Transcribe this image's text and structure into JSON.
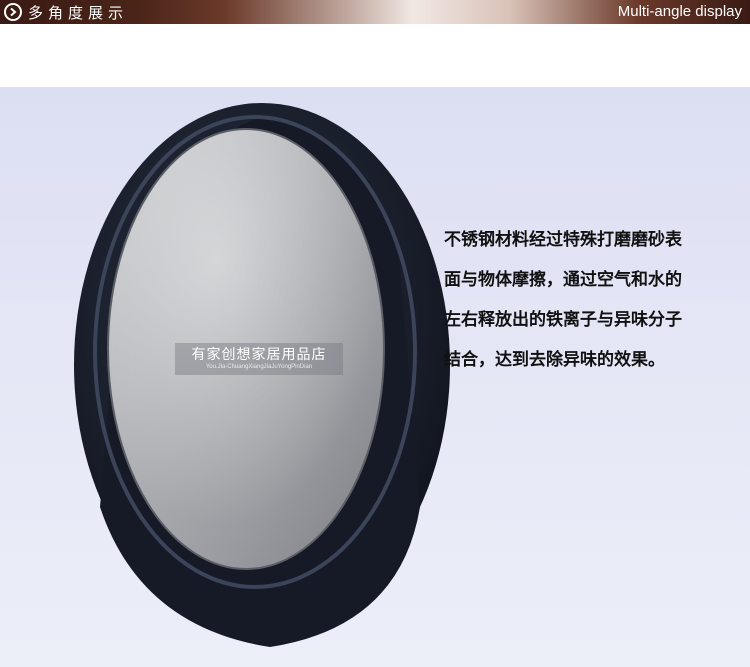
{
  "header": {
    "title_cn": "多角度展示",
    "title_en": "Multi-angle display",
    "icon": "chevron-right-circle-icon"
  },
  "watermark": {
    "cn": "有家创想家居用品店",
    "en": "You.Jia-ChuangXiangJiaJuYongPinDian"
  },
  "description": {
    "lines": [
      "不锈钢材料经过特殊打磨磨砂表",
      "面与物体摩擦，通过空气和水的",
      "左右释放出的铁离子与异味分子",
      "结合，达到去除异味的效果。"
    ]
  },
  "colors": {
    "header_dark": "#3a1a14",
    "header_light": "#f1e8e4",
    "background": "#e4e6f6",
    "holder": "#1a1f2c",
    "steel": "#a9aaae",
    "text": "#111111"
  }
}
